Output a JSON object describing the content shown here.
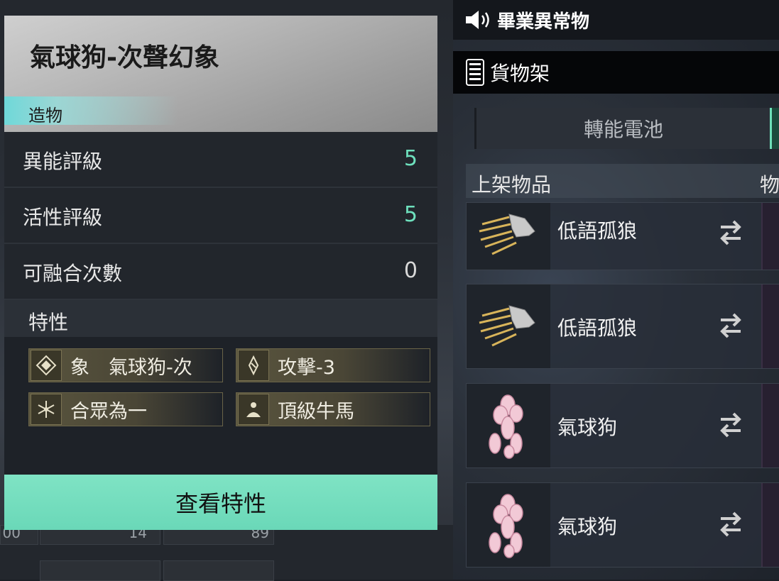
{
  "game_header": {
    "title": "畢業異常物"
  },
  "shelf": {
    "label": "貨物架"
  },
  "battery_tab": {
    "label": "轉能電池"
  },
  "columns": {
    "listed_items": "上架物品",
    "goods": "物"
  },
  "shelf_items": [
    {
      "name": "低語孤狼",
      "icon": "golden-wolf-head-icon"
    },
    {
      "name": "低語孤狼",
      "icon": "golden-wolf-head-icon"
    },
    {
      "name": "氣球狗",
      "icon": "pink-balloon-dog-icon"
    },
    {
      "name": "氣球狗",
      "icon": "pink-balloon-dog-icon"
    }
  ],
  "detail": {
    "title": "氣球狗-次聲幻象",
    "type": "造物",
    "stats": [
      {
        "label": "異能評級",
        "value": "5"
      },
      {
        "label": "活性評級",
        "value": "5"
      },
      {
        "label": "可融合次數",
        "value": "0"
      }
    ],
    "traits_label": "特性",
    "traits": [
      {
        "name": "象　氣球狗-次",
        "icon": "diamond-rune-icon"
      },
      {
        "name": "攻擊-3",
        "icon": "sword-rune-icon"
      },
      {
        "name": "合眾為一",
        "icon": "snowflake-icon"
      },
      {
        "name": "頂級牛馬",
        "icon": "worker-icon"
      }
    ],
    "view_button": "查看特性"
  },
  "background_cells": {
    "a": "00",
    "b": "14",
    "c": "89"
  },
  "colors": {
    "accent_green": "#6ee0bd",
    "button": "#74ddbf",
    "trait_gold": "#6a6448"
  }
}
